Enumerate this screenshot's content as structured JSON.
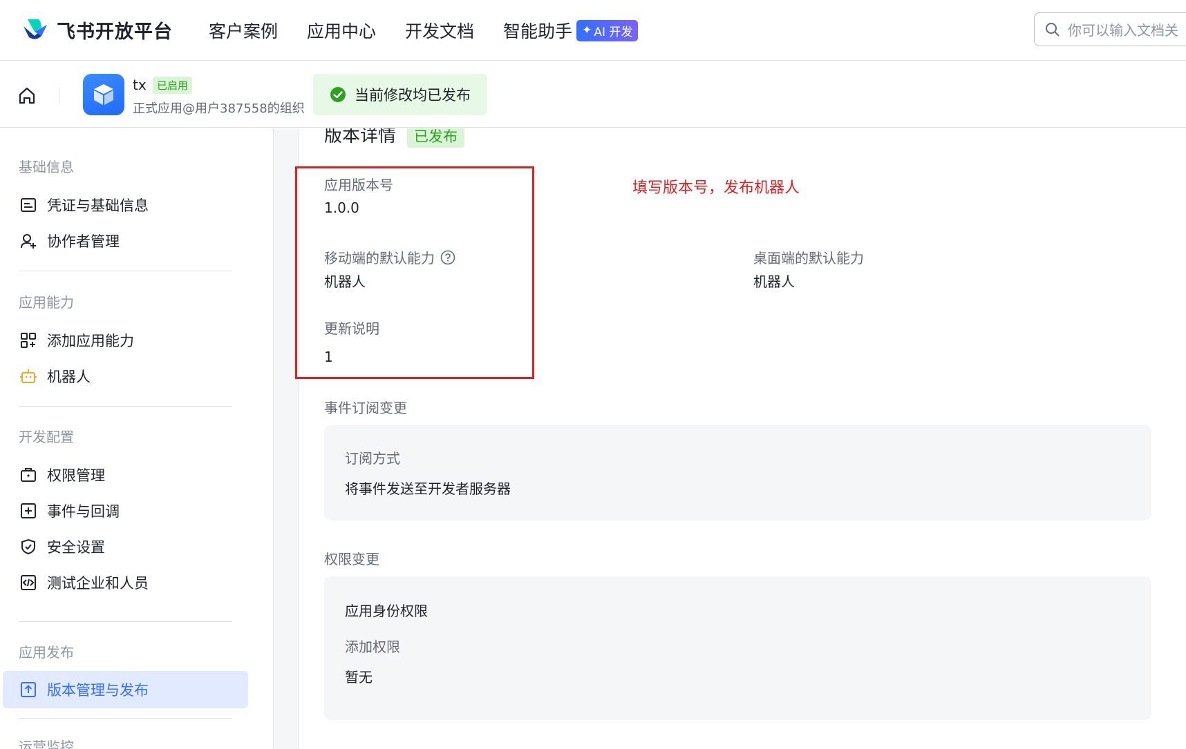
{
  "topnav": {
    "brand": "飞书开放平台",
    "links": [
      "客户案例",
      "应用中心",
      "开发文档",
      "智能助手"
    ],
    "ai_badge": "AI 开发",
    "search_placeholder": "你可以输入文档关"
  },
  "app_header": {
    "app_name": "tx",
    "status_badge": "已启用",
    "org": "正式应用@用户387558的组织",
    "toast": "当前修改均已发布"
  },
  "sidebar": {
    "sections": [
      {
        "title": "基础信息",
        "items": [
          "凭证与基础信息",
          "协作者管理"
        ]
      },
      {
        "title": "应用能力",
        "items": [
          "添加应用能力",
          "机器人"
        ]
      },
      {
        "title": "开发配置",
        "items": [
          "权限管理",
          "事件与回调",
          "安全设置",
          "测试企业和人员"
        ]
      },
      {
        "title": "应用发布",
        "items": [
          "版本管理与发布"
        ]
      },
      {
        "title": "运营监控",
        "items": []
      }
    ],
    "active_item": "版本管理与发布"
  },
  "version_detail": {
    "title": "版本详情",
    "status": "已发布",
    "version_label": "应用版本号",
    "version_value": "1.0.0",
    "mobile_label": "移动端的默认能力",
    "mobile_value": "机器人",
    "desktop_label": "桌面端的默认能力",
    "desktop_value": "机器人",
    "notes_label": "更新说明",
    "notes_value": "1",
    "annotation": "填写版本号，发布机器人"
  },
  "event_changes": {
    "title": "事件订阅变更",
    "method_label": "订阅方式",
    "method_value": "将事件发送至开发者服务器"
  },
  "permission_changes": {
    "title": "权限变更",
    "scope_title": "应用身份权限",
    "add_label": "添加权限",
    "add_value": "暂无"
  },
  "colors": {
    "accent": "#3370ff",
    "success": "#2ea121",
    "annotation_red": "#e02020"
  }
}
